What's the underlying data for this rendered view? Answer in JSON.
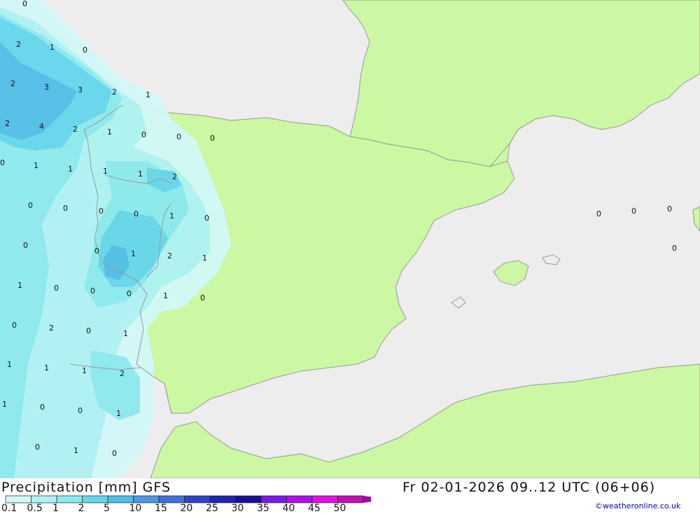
{
  "title_left": "Precipitation [mm] GFS",
  "title_right": "Fr 02-01-2026 09..12 UTC (06+06)",
  "credit": "©weatheronline.co.uk",
  "colors": {
    "sea": "#ededed",
    "land": "#ccf8a3",
    "border": "#999999",
    "coast": "#999999"
  },
  "legend": [
    {
      "label": "0.1",
      "color": "#d2f8f8"
    },
    {
      "label": "0.5",
      "color": "#aef2f5"
    },
    {
      "label": "1",
      "color": "#8be9ee"
    },
    {
      "label": "2",
      "color": "#65d6ec"
    },
    {
      "label": "5",
      "color": "#50bde8"
    },
    {
      "label": "10",
      "color": "#4a98e0"
    },
    {
      "label": "15",
      "color": "#3f6fd8"
    },
    {
      "label": "20",
      "color": "#2d45c4"
    },
    {
      "label": "25",
      "color": "#1e24ac"
    },
    {
      "label": "30",
      "color": "#1a0f90"
    },
    {
      "label": "35",
      "color": "#7a18e8"
    },
    {
      "label": "40",
      "color": "#b010e8"
    },
    {
      "label": "45",
      "color": "#e010e0"
    },
    {
      "label": "50",
      "color": "#c010b8"
    }
  ],
  "map_values": [
    "0",
    "2",
    "1",
    "0",
    "2",
    "3",
    "3",
    "2",
    "1",
    "2",
    "4",
    "2",
    "1",
    "0",
    "0",
    "0",
    "0",
    "1",
    "1",
    "1",
    "1",
    "2",
    "0",
    "0",
    "0",
    "0",
    "1",
    "0",
    "0",
    "0",
    "1",
    "2",
    "1",
    "1",
    "0",
    "0",
    "0",
    "1",
    "0",
    "0",
    "2",
    "0",
    "1",
    "1",
    "1",
    "1",
    "2",
    "1",
    "0",
    "0",
    "1",
    "0",
    "1",
    "0",
    "0",
    "0",
    "0",
    "0"
  ]
}
